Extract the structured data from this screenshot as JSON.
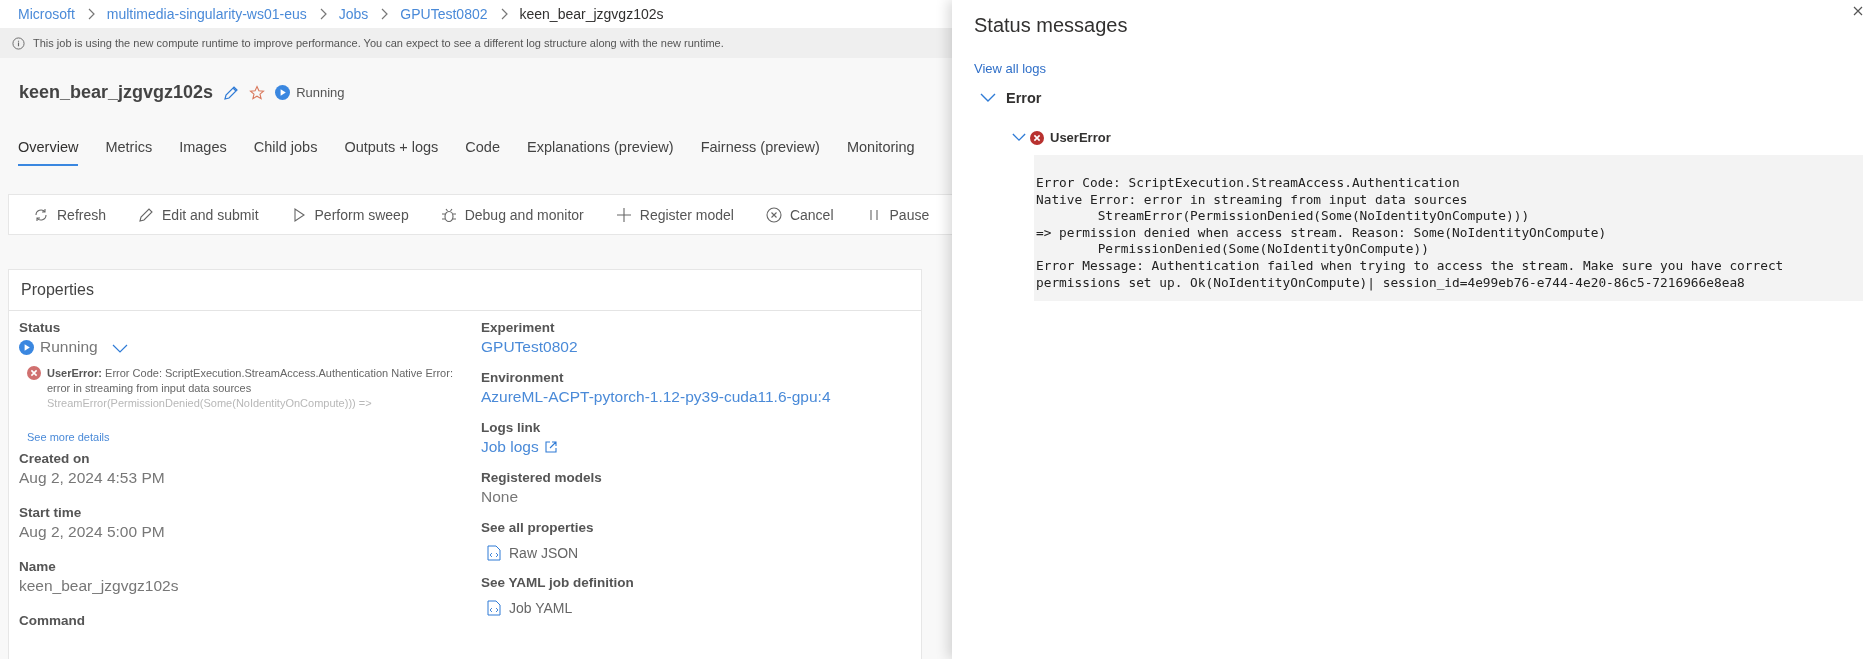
{
  "breadcrumb": [
    {
      "label": "Microsoft",
      "current": false
    },
    {
      "label": "multimedia-singularity-ws01-eus",
      "current": false
    },
    {
      "label": "Jobs",
      "current": false
    },
    {
      "label": "GPUTest0802",
      "current": false
    },
    {
      "label": "keen_bear_jzgvgz102s",
      "current": true
    }
  ],
  "info_bar": {
    "text": "This job is using the new compute runtime to improve performance. You can expect to see a different log structure along with the new runtime."
  },
  "job": {
    "title": "keen_bear_jzgvgz102s",
    "status": "Running"
  },
  "tabs": [
    {
      "label": "Overview",
      "selected": true
    },
    {
      "label": "Metrics",
      "selected": false
    },
    {
      "label": "Images",
      "selected": false
    },
    {
      "label": "Child jobs",
      "selected": false
    },
    {
      "label": "Outputs + logs",
      "selected": false
    },
    {
      "label": "Code",
      "selected": false
    },
    {
      "label": "Explanations (preview)",
      "selected": false
    },
    {
      "label": "Fairness (preview)",
      "selected": false
    },
    {
      "label": "Monitoring",
      "selected": false
    }
  ],
  "toolbar": [
    {
      "kind": "refresh",
      "label": "Refresh"
    },
    {
      "kind": "edit",
      "label": "Edit and submit"
    },
    {
      "kind": "play",
      "label": "Perform sweep"
    },
    {
      "kind": "bug",
      "label": "Debug and monitor"
    },
    {
      "kind": "add",
      "label": "Register model"
    },
    {
      "kind": "cancel",
      "label": "Cancel"
    },
    {
      "kind": "pause",
      "label": "Pause"
    }
  ],
  "properties": {
    "title": "Properties",
    "left": [
      {
        "kind": "status",
        "label": "Status",
        "value": "Running",
        "error_label": "UserError:",
        "error_text": "Error Code: ScriptExecution.StreamAccess.Authentication Native Error: error in streaming from input data sources",
        "error_faded": "StreamError(PermissionDenied(Some(NoIdentityOnCompute))) =>",
        "link": "See more details"
      },
      {
        "kind": "text",
        "label": "Created on",
        "value": "Aug 2, 2024 4:53 PM"
      },
      {
        "kind": "text",
        "label": "Start time",
        "value": "Aug 2, 2024 5:00 PM"
      },
      {
        "kind": "text",
        "label": "Name",
        "value": "keen_bear_jzgvgz102s"
      },
      {
        "kind": "text",
        "label": "Command"
      }
    ],
    "right": [
      {
        "kind": "link",
        "label": "Experiment",
        "value": "GPUTest0802"
      },
      {
        "kind": "link",
        "label": "Environment",
        "value": "AzureML-ACPT-pytorch-1.12-py39-cuda11.6-gpu:4"
      },
      {
        "kind": "external",
        "label": "Logs link",
        "value": "Job logs"
      },
      {
        "kind": "text",
        "label": "Registered models",
        "value": "None"
      },
      {
        "kind": "file",
        "label": "See all properties",
        "value": "Raw JSON"
      },
      {
        "kind": "file",
        "label": "See YAML job definition",
        "value": "Job YAML"
      }
    ]
  },
  "status_panel": {
    "title": "Status messages",
    "link": "View all logs",
    "section": {
      "label": "Error",
      "expanded": true,
      "items": [
        {
          "label": "UserError",
          "expanded": true,
          "code": "Error Code: ScriptExecution.StreamAccess.Authentication\nNative Error: error in streaming from input data sources\n        StreamError(PermissionDenied(Some(NoIdentityOnCompute)))\n=> permission denied when access stream. Reason: Some(NoIdentityOnCompute)\n        PermissionDenied(Some(NoIdentityOnCompute))\nError Message: Authentication failed when trying to access the stream. Make sure you have correct\npermissions set up. Ok(NoIdentityOnCompute)| session_id=4e99eb76-e744-4e20-86c5-7216966e8ea8"
        }
      ]
    }
  }
}
